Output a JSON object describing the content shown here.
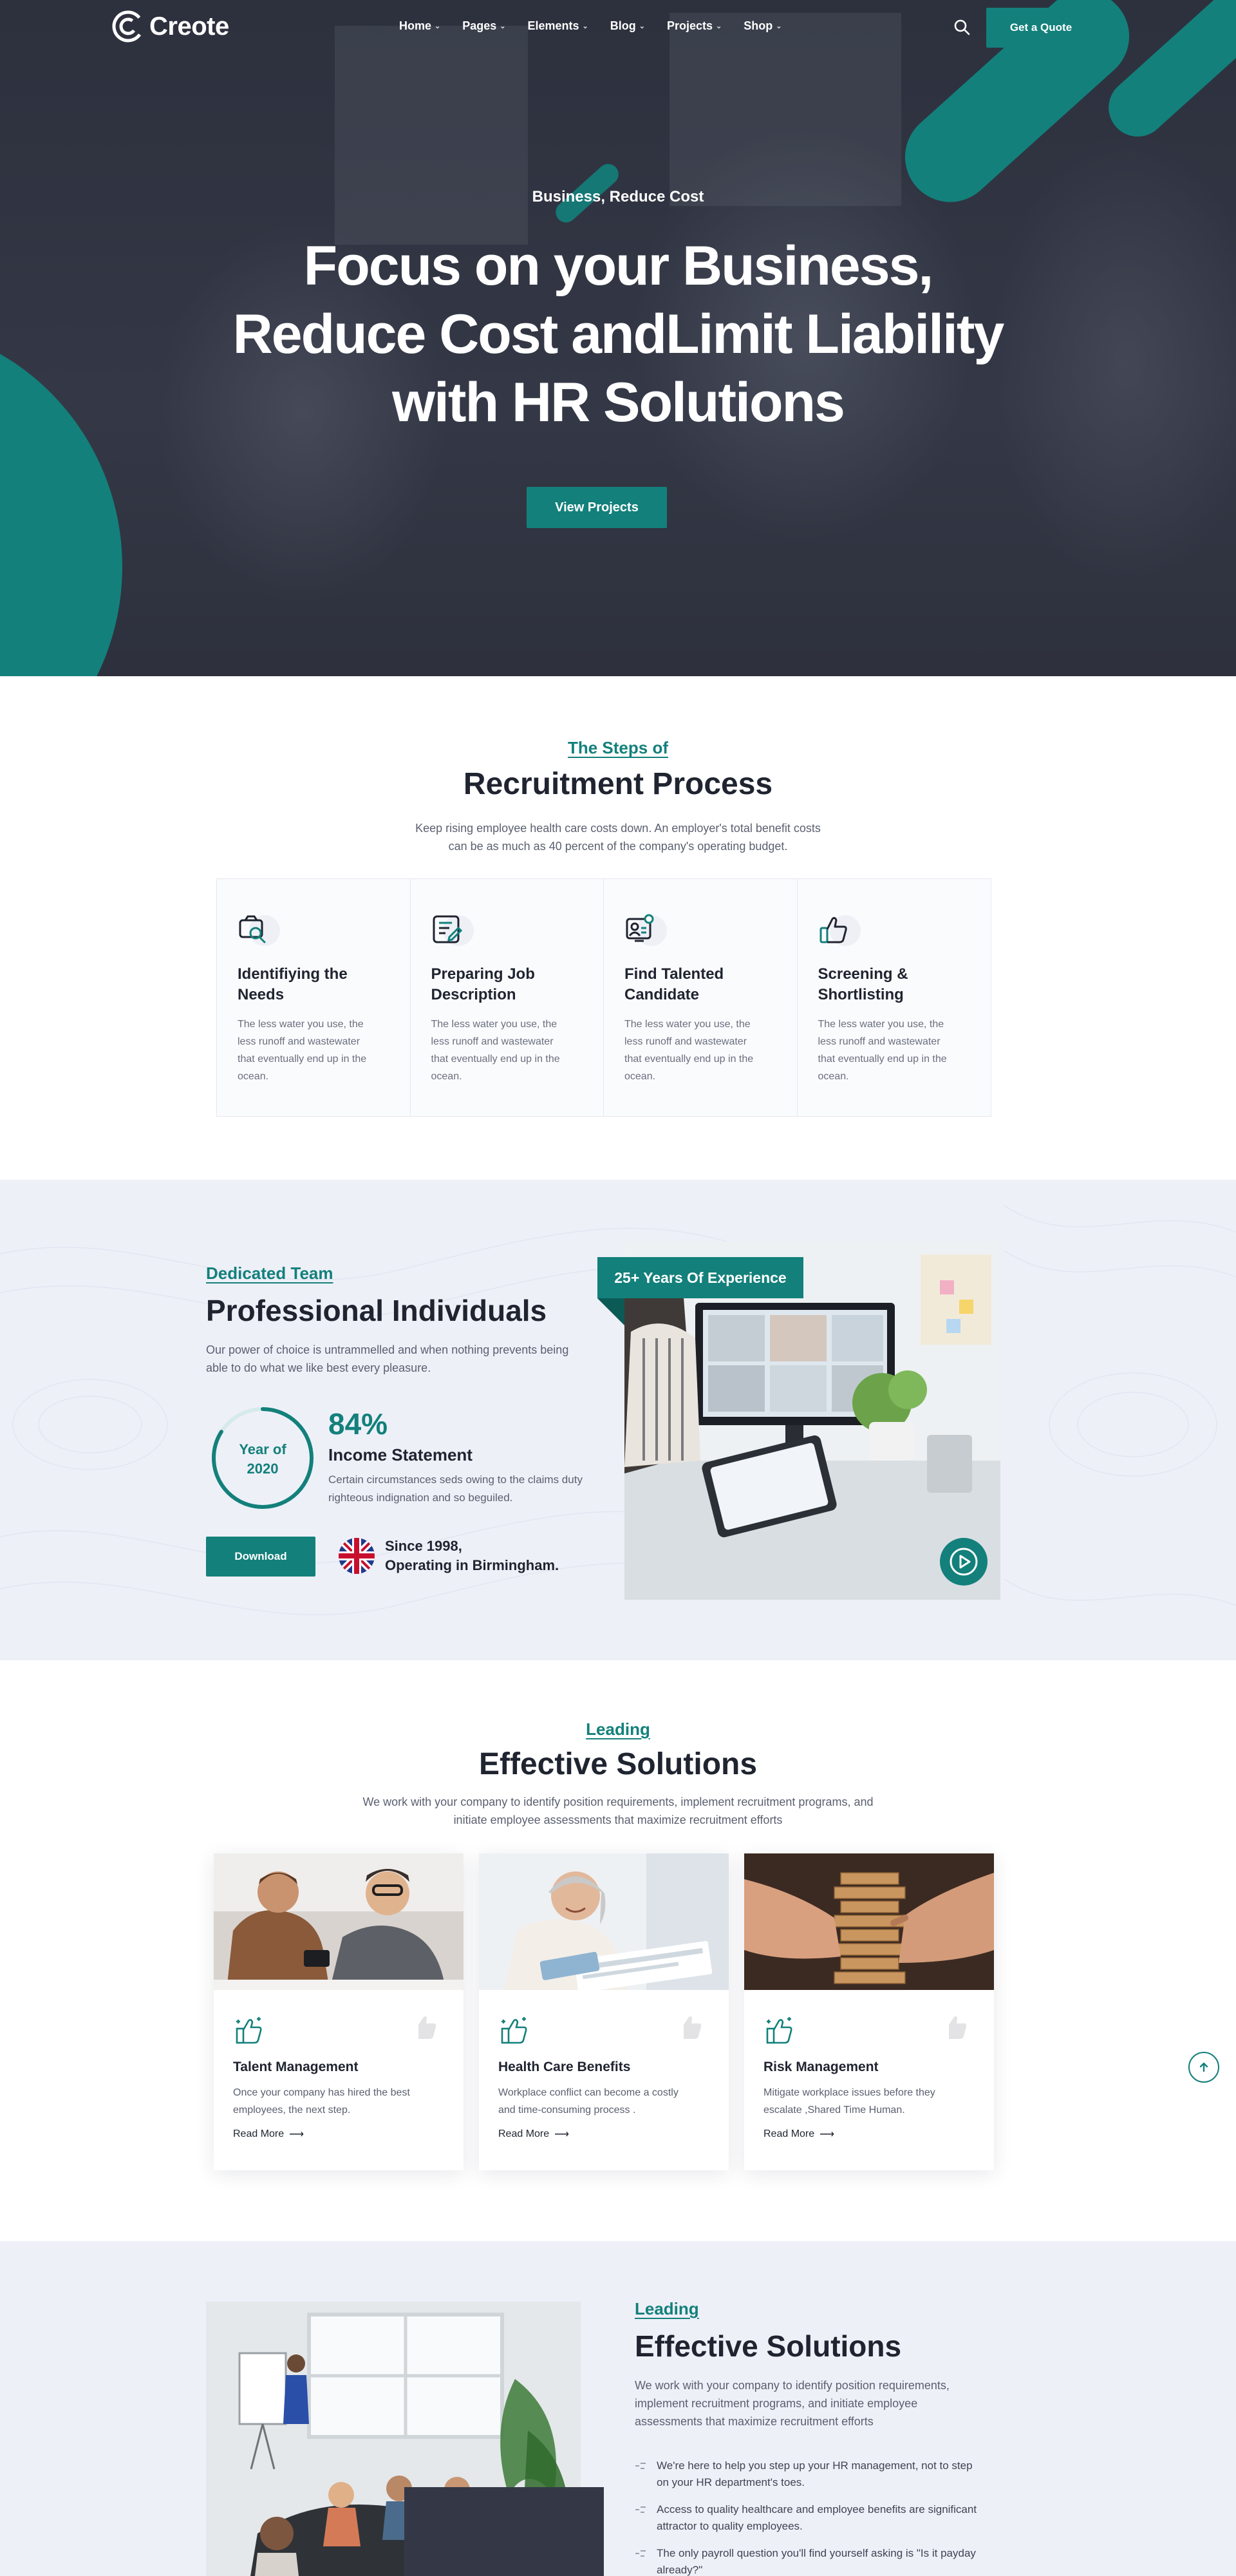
{
  "brand": {
    "name": "Creote",
    "accent": "#13807b",
    "dark": "#343846"
  },
  "nav": {
    "items": [
      {
        "label": "Home"
      },
      {
        "label": "Pages"
      },
      {
        "label": "Elements"
      },
      {
        "label": "Blog"
      },
      {
        "label": "Projects"
      },
      {
        "label": "Shop"
      }
    ],
    "cta_label": "Get a Quote"
  },
  "hero": {
    "kicker": "Business, Reduce Cost",
    "title_lines": [
      "Focus on your Business,",
      "Reduce Cost andLimit Liability",
      "with HR Solutions"
    ],
    "cta_label": "View Projects"
  },
  "recruitment": {
    "kicker": "The Steps of",
    "title": "Recruitment Process",
    "desc_lines": [
      "Keep rising employee health care costs down. An employer's total benefit costs",
      "can be as much as 40 percent of the company's operating budget."
    ],
    "steps": [
      {
        "icon": "search-icon",
        "title_lines": [
          "Identifiying the",
          "Needs"
        ],
        "text_lines": [
          "The less water you use, the",
          "less runoff and wastewater",
          "that eventually end up in the",
          "ocean."
        ]
      },
      {
        "icon": "job-description-icon",
        "title_lines": [
          "Preparing Job",
          "Description"
        ],
        "text_lines": [
          "The less water you use, the",
          "less runoff and wastewater",
          "that eventually end up in the",
          "ocean."
        ]
      },
      {
        "icon": "candidate-icon",
        "title_lines": [
          "Find Talented",
          "Candidate"
        ],
        "text_lines": [
          "The less water you use, the",
          "less runoff and wastewater",
          "that eventually end up in the",
          "ocean."
        ]
      },
      {
        "icon": "thumbs-up-icon",
        "title_lines": [
          "Screening &",
          "Shortlisting"
        ],
        "text_lines": [
          "The less water you use, the",
          "less runoff and wastewater",
          "that eventually end up in the",
          "ocean."
        ]
      }
    ]
  },
  "team": {
    "kicker": "Dedicated Team",
    "title": "Professional Individuals",
    "desc_lines": [
      "Our power of choice is untrammelled and when nothing prevents being",
      "able to do what we like best every pleasure."
    ],
    "ring_label_lines": [
      "Year of",
      "2020"
    ],
    "stat_value": "84%",
    "stat_percent": 84,
    "stat_title": "Income Statement",
    "stat_desc_lines": [
      "Certain circumstances seds owing to the claims duty",
      "righteous indignation and so beguiled."
    ],
    "download_label": "Download",
    "since_lines": [
      "Since 1998,",
      "Operating in Birmingham."
    ],
    "experience_badge": "25+ Years Of Experience"
  },
  "solutions": {
    "kicker": "Leading",
    "title": "Effective Solutions",
    "desc_lines": [
      "We work with your company to identify position requirements, implement recruitment programs, and",
      "initiate employee assessments that maximize recruitment efforts"
    ],
    "cards": [
      {
        "title": "Talent Management",
        "text_lines": [
          "Once your company has hired the best",
          "employees, the next step."
        ],
        "link": "Read More"
      },
      {
        "title": "Health Care Benefits",
        "text_lines": [
          "Workplace conflict can become a costly",
          "and time-consuming process ."
        ],
        "link": "Read More"
      },
      {
        "title": "Risk Management",
        "text_lines": [
          "Mitigate workplace issues before they",
          "escalate ,Shared Time Human."
        ],
        "link": "Read More"
      }
    ]
  },
  "bottom": {
    "kicker": "Leading",
    "title": "Effective Solutions",
    "desc_lines": [
      "We work with your company to identify position requirements,",
      "implement recruitment programs, and initiate employee",
      "assessments that maximize recruitment efforts"
    ],
    "list": [
      [
        "We're here to help you step up your HR management, not to step",
        "on your HR department's toes."
      ],
      [
        "Access to quality healthcare and employee benefits are significant",
        "attractor to quality employees."
      ],
      [
        "The only payroll question you'll find yourself asking is \"Is it payday",
        "already?\""
      ]
    ]
  }
}
